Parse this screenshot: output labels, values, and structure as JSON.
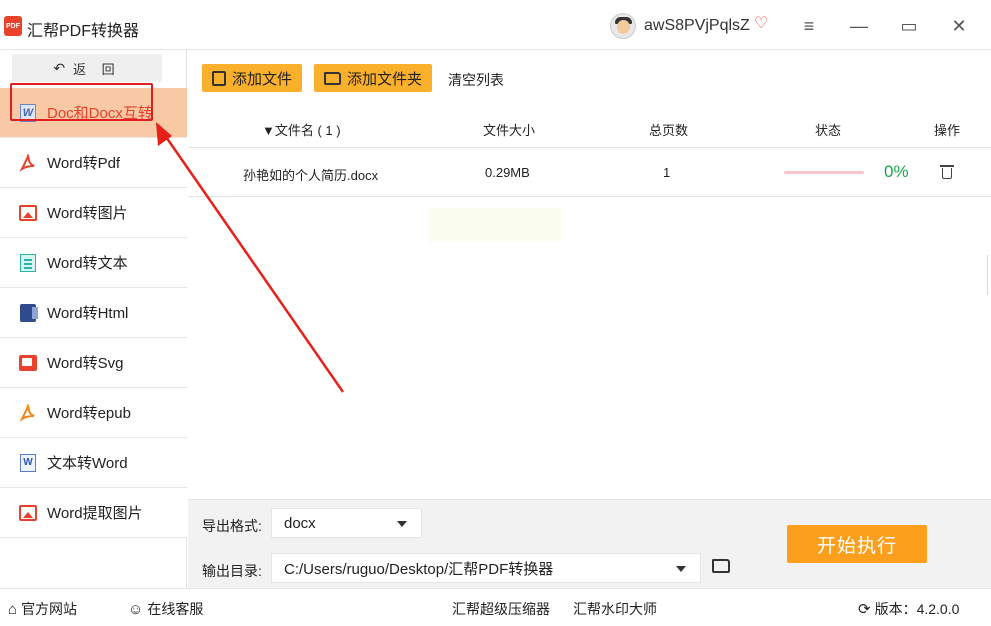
{
  "app": {
    "title": "汇帮PDF转换器",
    "logo_text": "PDF",
    "user_name": "awS8PVjPqlsZ"
  },
  "window": {
    "menu_glyph": "≡",
    "minimize_glyph": "—",
    "maximize_glyph": "▭",
    "close_glyph": "✕"
  },
  "sidebar": {
    "back_label": "返  回",
    "items": [
      {
        "label": "Doc和Docx互转",
        "icon": "word-icon",
        "active": true
      },
      {
        "label": "Word转Pdf",
        "icon": "acrobat-icon"
      },
      {
        "label": "Word转图片",
        "icon": "image-icon"
      },
      {
        "label": "Word转文本",
        "icon": "text-file-icon"
      },
      {
        "label": "Word转Html",
        "icon": "html-file-icon"
      },
      {
        "label": "Word转Svg",
        "icon": "svg-image-icon"
      },
      {
        "label": "Word转epub",
        "icon": "acrobat-icon"
      },
      {
        "label": "文本转Word",
        "icon": "word-doc-icon"
      },
      {
        "label": "Word提取图片",
        "icon": "image-icon"
      }
    ]
  },
  "toolbar": {
    "add_file_label": "添加文件",
    "add_folder_label": "添加文件夹",
    "clear_list_label": "清空列表"
  },
  "table": {
    "headers": {
      "file_name": "文件名 ( 1 )",
      "file_size": "文件大小",
      "total_pages": "总页数",
      "status": "状态",
      "actions": "操作"
    },
    "rows": [
      {
        "file_name": "孙艳如的个人简历.docx",
        "file_size": "0.29MB",
        "total_pages": "1",
        "progress": 0,
        "progress_text": "0%"
      }
    ]
  },
  "settings": {
    "format_label": "导出格式:",
    "format_value": "docx",
    "output_label": "输出目录:",
    "output_value": "C:/Users/ruguo/Desktop/汇帮PDF转换器",
    "start_label": "开始执行"
  },
  "footer": {
    "website_label": "官方网站",
    "support_label": "在线客服",
    "compressor_label": "汇帮超级压缩器",
    "watermark_label": "汇帮水印大师",
    "version_label": "版本：",
    "version_value": "4.2.0.0"
  },
  "colors": {
    "accent_orange": "#fbb02b",
    "start_button": "#fb9f1d",
    "brand_red": "#e8412c",
    "active_item_bg": "#f8c9a4",
    "progress_green": "#1aa74a"
  }
}
